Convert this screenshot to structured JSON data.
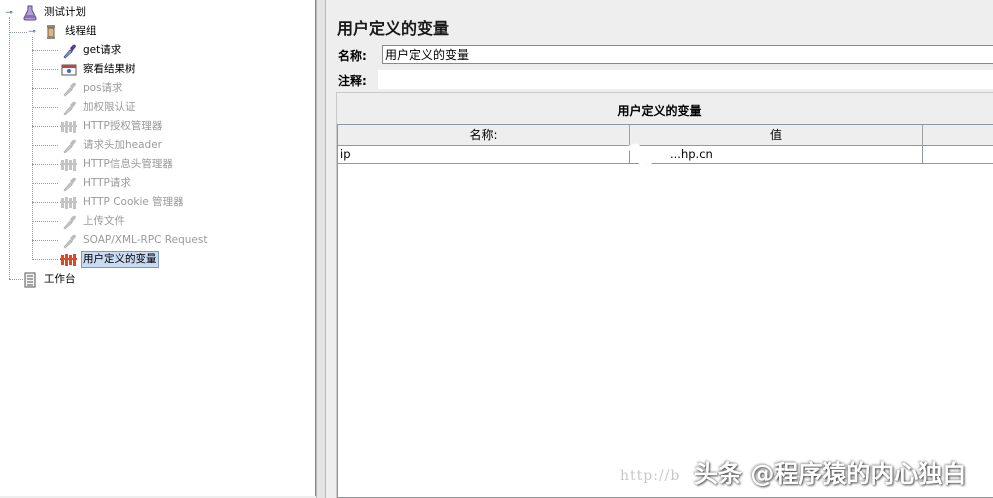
{
  "tree": {
    "root": {
      "label": "测试计划",
      "icon": "test-plan-icon"
    },
    "thread_group": {
      "label": "线程组",
      "icon": "thread-group-icon"
    },
    "items": [
      {
        "label": "get请求",
        "icon": "sampler-pipette-icon",
        "disabled": false,
        "selected": false
      },
      {
        "label": "察看结果树",
        "icon": "results-tree-icon",
        "disabled": false,
        "selected": false
      },
      {
        "label": "pos请求",
        "icon": "sampler-pipette-icon",
        "disabled": true,
        "selected": false
      },
      {
        "label": "加权限认证",
        "icon": "sampler-pipette-icon",
        "disabled": true,
        "selected": false
      },
      {
        "label": "HTTP授权管理器",
        "icon": "config-element-icon",
        "disabled": true,
        "selected": false
      },
      {
        "label": "请求头加header",
        "icon": "sampler-pipette-icon",
        "disabled": true,
        "selected": false
      },
      {
        "label": "HTTP信息头管理器",
        "icon": "config-element-icon",
        "disabled": true,
        "selected": false
      },
      {
        "label": "HTTP请求",
        "icon": "sampler-pipette-icon",
        "disabled": true,
        "selected": false
      },
      {
        "label": "HTTP Cookie 管理器",
        "icon": "config-element-icon",
        "disabled": true,
        "selected": false
      },
      {
        "label": "上传文件",
        "icon": "sampler-pipette-icon",
        "disabled": true,
        "selected": false
      },
      {
        "label": "SOAP/XML-RPC Request",
        "icon": "sampler-pipette-icon",
        "disabled": true,
        "selected": false
      },
      {
        "label": "用户定义的变量",
        "icon": "config-element-icon",
        "disabled": false,
        "selected": true
      }
    ],
    "workbench": {
      "label": "工作台",
      "icon": "workbench-icon"
    }
  },
  "main": {
    "title": "用户定义的变量",
    "name_label": "名称:",
    "name_value": "用户定义的变量",
    "comment_label": "注释:",
    "comment_value": "",
    "table_title": "用户定义的变量",
    "columns": [
      "名称:",
      "值",
      ""
    ],
    "rows": [
      {
        "name": "ip",
        "value": "...hp.cn",
        "description": ""
      }
    ]
  },
  "watermark": {
    "url": "http://b",
    "brand": "头条 @程序猿的内心独白"
  },
  "colors": {
    "selection_bg": "#c9daf3",
    "disabled_text": "#9a9a9a",
    "panel_bg": "#eeeeee"
  }
}
